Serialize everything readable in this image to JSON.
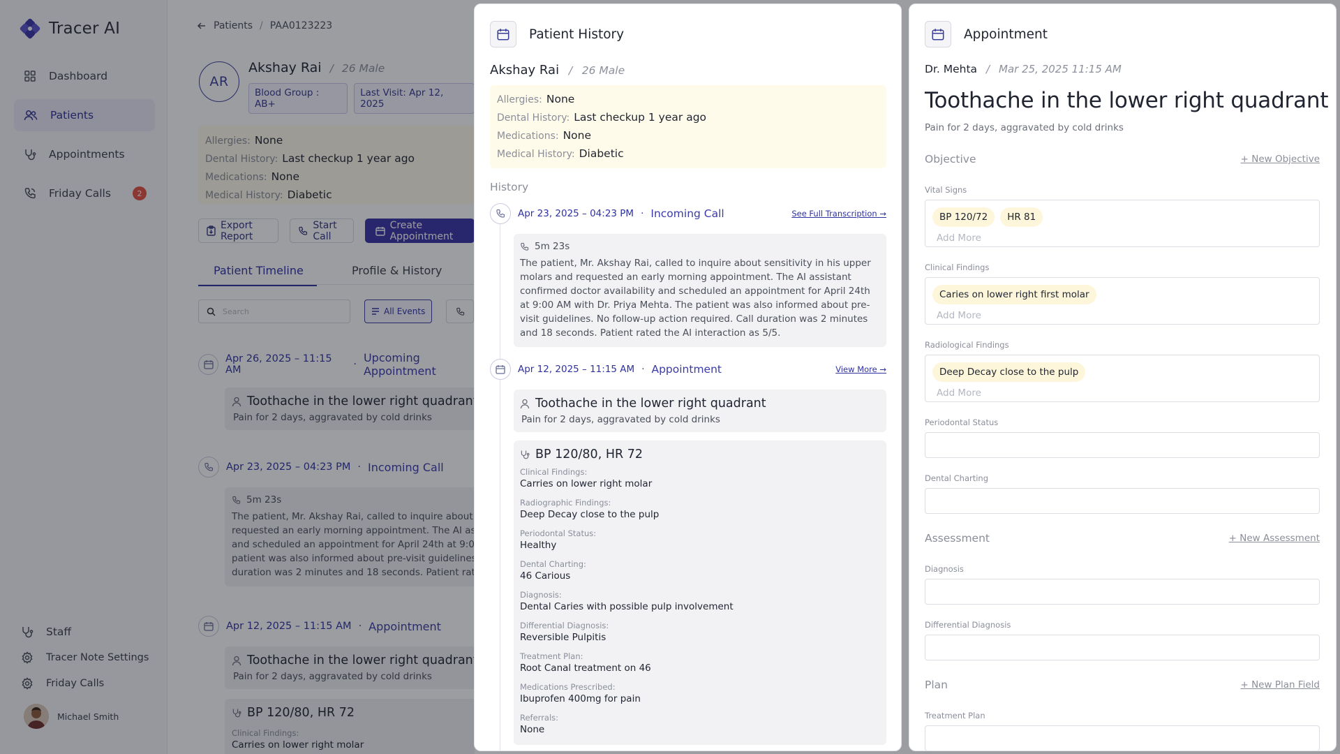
{
  "app": {
    "name": "Tracer AI"
  },
  "sidebar": {
    "items": [
      {
        "label": "Dashboard",
        "icon": "dashboard-icon"
      },
      {
        "label": "Patients",
        "icon": "users-icon",
        "active": true
      },
      {
        "label": "Appointments",
        "icon": "stethoscope-icon"
      },
      {
        "label": "Friday Calls",
        "icon": "phone-icon",
        "badge": "2"
      }
    ],
    "bottom_items": [
      {
        "label": "Staff",
        "icon": "stethoscope-icon"
      },
      {
        "label": "Tracer Note Settings",
        "icon": "gear-icon"
      },
      {
        "label": "Friday Calls",
        "icon": "gear-icon"
      }
    ],
    "user": {
      "name": "Michael Smith"
    }
  },
  "breadcrumb": {
    "parent": "Patients",
    "sep": "/",
    "current": "PAA0123223"
  },
  "patient": {
    "initials": "AR",
    "name": "Akshay Rai",
    "sep": "/",
    "meta": "26 Male",
    "blood_group": "Blood Group : AB+",
    "last_visit": "Last Visit: Apr 12, 2025",
    "info": [
      {
        "label": "Allergies:",
        "value": "None"
      },
      {
        "label": "Dental History:",
        "value": "Last checkup 1 year ago"
      },
      {
        "label": "Medications:",
        "value": "None"
      },
      {
        "label": "Medical History:",
        "value": "Diabetic"
      }
    ]
  },
  "actions": {
    "export": "Export Report",
    "start_call": "Start Call",
    "create": "Create Appointment"
  },
  "tabs": {
    "timeline": "Patient Timeline",
    "profile": "Profile & History"
  },
  "filters": {
    "search_placeholder": "Search",
    "all_events": "All Events"
  },
  "timeline": [
    {
      "date": "Apr 26, 2025 – 11:15 AM",
      "dot": "·",
      "type": "Upcoming Appointment",
      "title": "Toothache in the lower right quadrant",
      "sub": "Pain for 2 days, aggravated by cold drinks"
    },
    {
      "date": "Apr 23, 2025 –  04:23 PM",
      "dot": "·",
      "type": "Incoming Call",
      "duration": "5m 23s",
      "text": "The patient, Mr. Akshay Rai, called to inquire about sens\nrequested an early morning appointment. The AI assista\nand scheduled an appointment for April 24th at 9:00 AN\npatient was also informed about pre-visit guidelines. No\nduration was 2 minutes and 18 seconds. Patient rated th"
    },
    {
      "date": "Apr 12, 2025 – 11:15 AM",
      "dot": "·",
      "type": "Appointment",
      "title": "Toothache in the lower right quadrant",
      "sub": "Pain for 2 days, aggravated by cold drinks",
      "vitals": "BP 120/80, HR 72",
      "finding_label": "Clinical Findings:",
      "finding_value": "Carries on lower right molar"
    }
  ],
  "history_panel": {
    "title": "Patient History",
    "section": "History",
    "call": {
      "date": "Apr 23, 2025 –  04:23 PM",
      "dot": "·",
      "type": "Incoming Call",
      "link": "See Full Transcription →",
      "duration": "5m 23s",
      "text": "The patient, Mr. Akshay Rai, called to inquire about sensitivity in his upper molars and requested an early morning appointment. The AI assistant confirmed doctor availability and scheduled an appointment for April 24th at 9:00 AM with Dr. Priya Mehta. The patient was also informed about pre-visit guidelines. No follow-up action required. Call duration was 2 minutes and 18 seconds. Patient rated the AI interaction as 5/5."
    },
    "appointment": {
      "date": "Apr 12, 2025 – 11:15 AM",
      "dot": "·",
      "type": "Appointment",
      "link": "View More →",
      "title": "Toothache in the lower right quadrant",
      "sub": "Pain for 2 days, aggravated by cold drinks",
      "vitals": "BP 120/80, HR 72",
      "fields": [
        {
          "label": "Clinical Findings:",
          "value": "Carries on lower right molar"
        },
        {
          "label": "Radiographic Findings:",
          "value": "Deep Decay close to the pulp"
        },
        {
          "label": "Periodontal Status:",
          "value": "Healthy"
        },
        {
          "label": "Dental Charting:",
          "value": "46 Carious"
        },
        {
          "label": "Diagnosis:",
          "value": "Dental Caries with possible pulp involvement"
        },
        {
          "label": "Differential Diagnosis:",
          "value": "Reversible Pulpitis"
        },
        {
          "label": "Treatment Plan:",
          "value": "Root Canal treatment on 46"
        },
        {
          "label": "Medications Prescribed:",
          "value": "Ibuprofen 400mg for pain"
        },
        {
          "label": "Referrals:",
          "value": "None"
        }
      ]
    }
  },
  "appointment_panel": {
    "title": "Appointment",
    "doctor": "Dr. Mehta",
    "sep": "/",
    "datetime": "Mar 25, 2025 11:15 AM",
    "heading": "Toothache in the lower right quadrant",
    "sub": "Pain for 2 days, aggravated by cold drinks",
    "objective": {
      "label": "Objective",
      "add": "+ New Objective"
    },
    "vital_signs": {
      "label": "Vital Signs",
      "chips": [
        "BP 120/72",
        "HR 81"
      ]
    },
    "clinical_findings": {
      "label": "Clinical Findings",
      "chips": [
        "Caries on lower right first molar"
      ]
    },
    "radiological_findings": {
      "label": "Radiological Findings",
      "chips": [
        "Deep Decay close to the pulp"
      ]
    },
    "add_more": "Add More",
    "periodontal_status": {
      "label": "Periodontal Status"
    },
    "dental_charting": {
      "label": "Dental Charting"
    },
    "assessment": {
      "label": "Assessment",
      "add": "+ New Assessment"
    },
    "diagnosis": {
      "label": "Diagnosis"
    },
    "differential_diagnosis": {
      "label": "Differential Diagnosis"
    },
    "plan": {
      "label": "Plan",
      "add": "+ New Plan Field"
    },
    "treatment_plan": {
      "label": "Treatment Plan"
    }
  },
  "colors": {
    "accent": "#3834a6",
    "badge": "#e25241",
    "info_bg": "#fffbea",
    "chip_bg": "#fdf6db"
  }
}
